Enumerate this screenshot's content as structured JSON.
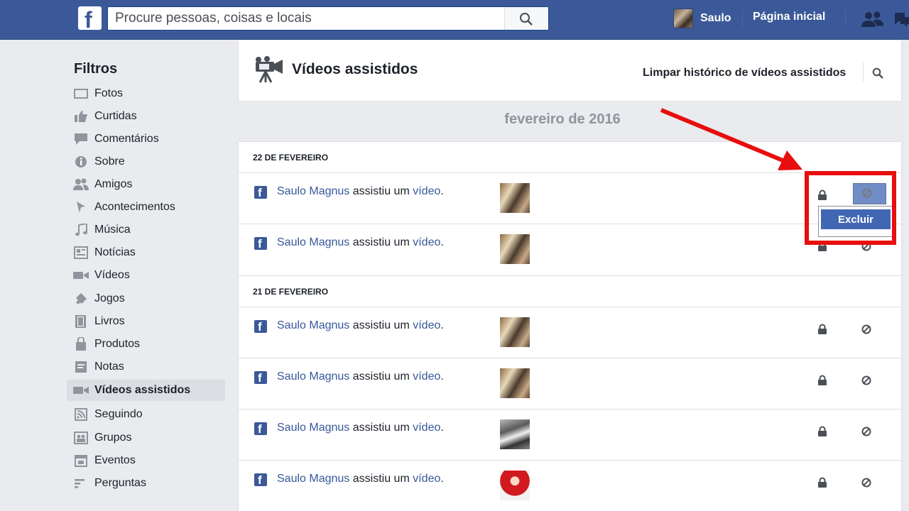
{
  "topbar": {
    "logo": "f",
    "search_placeholder": "Procure pessoas, coisas e locais",
    "user_name": "Saulo",
    "home_label": "Página inicial"
  },
  "sidebar": {
    "title": "Filtros",
    "items": [
      {
        "label": "Fotos",
        "icon": "photos-icon"
      },
      {
        "label": "Curtidas",
        "icon": "like-icon"
      },
      {
        "label": "Comentários",
        "icon": "comment-icon"
      },
      {
        "label": "Sobre",
        "icon": "info-icon"
      },
      {
        "label": "Amigos",
        "icon": "friends-icon"
      },
      {
        "label": "Acontecimentos",
        "icon": "flag-icon"
      },
      {
        "label": "Música",
        "icon": "music-icon"
      },
      {
        "label": "Notícias",
        "icon": "news-icon"
      },
      {
        "label": "Vídeos",
        "icon": "video-icon"
      },
      {
        "label": "Jogos",
        "icon": "game-icon"
      },
      {
        "label": "Livros",
        "icon": "book-icon"
      },
      {
        "label": "Produtos",
        "icon": "shopping-bag-icon"
      },
      {
        "label": "Notas",
        "icon": "notes-icon"
      },
      {
        "label": "Vídeos assistidos",
        "icon": "video-icon"
      },
      {
        "label": "Seguindo",
        "icon": "rss-icon"
      },
      {
        "label": "Grupos",
        "icon": "groups-icon"
      },
      {
        "label": "Eventos",
        "icon": "calendar-icon"
      },
      {
        "label": "Perguntas",
        "icon": "questions-icon"
      }
    ],
    "active_index": 13
  },
  "main": {
    "title": "Vídeos assistidos",
    "clear_history": "Limpar histórico de vídeos assistidos",
    "month": "fevereiro de 2016",
    "days": [
      {
        "label": "22 DE FEVEREIRO",
        "entries": [
          {
            "user": "Saulo Magnus",
            "action": " assistiu um ",
            "object": "vídeo",
            "end": ".",
            "thumb": "t1"
          },
          {
            "user": "Saulo Magnus",
            "action": " assistiu um ",
            "object": "vídeo",
            "end": ".",
            "thumb": "t1"
          }
        ]
      },
      {
        "label": "21 DE FEVEREIRO",
        "entries": [
          {
            "user": "Saulo Magnus",
            "action": " assistiu um ",
            "object": "vídeo",
            "end": ".",
            "thumb": "t1"
          },
          {
            "user": "Saulo Magnus",
            "action": " assistiu um ",
            "object": "vídeo",
            "end": ".",
            "thumb": "t1"
          },
          {
            "user": "Saulo Magnus",
            "action": " assistiu um ",
            "object": "vídeo",
            "end": ".",
            "thumb": "t2"
          },
          {
            "user": "Saulo Magnus",
            "action": " assistiu um ",
            "object": "vídeo",
            "end": ".",
            "thumb": "t3"
          }
        ]
      }
    ],
    "dropdown_label": "Excluir"
  },
  "colors": {
    "brand": "#3b5998",
    "annotation": "#e80e0e"
  }
}
